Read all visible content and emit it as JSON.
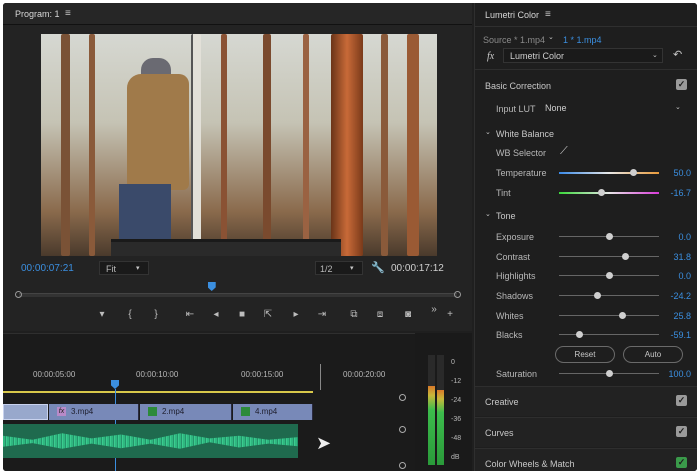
{
  "program": {
    "title": "Program: 1",
    "menu_icon": "hamburger-icon",
    "timecode_current": "00:00:07:21",
    "fit_label": "Fit",
    "resolution": "1/2",
    "timecode_total": "00:00:17:12",
    "playhead_fraction": 0.44
  },
  "transport": {
    "icons": [
      "marker-icon",
      "mark-in-icon",
      "mark-out-icon",
      "go-to-in-icon",
      "step-back-icon",
      "stop-icon",
      "lift-icon",
      "step-forward-icon",
      "go-to-out-icon",
      "insert-icon",
      "overwrite-icon",
      "export-frame-icon",
      "more-icon",
      "add-icon"
    ]
  },
  "timeline": {
    "ruler": [
      "00:00:05:00",
      "00:00:10:00",
      "00:00:15:00",
      "00:00:20:00"
    ],
    "clips": [
      {
        "label": "3.mp4",
        "badge": "fx"
      },
      {
        "label": "2.mp4",
        "badge": ""
      },
      {
        "label": "4.mp4",
        "badge": ""
      }
    ]
  },
  "meter": {
    "labels": [
      "0",
      "-12",
      "-24",
      "-36",
      "-48",
      "dB"
    ],
    "level_left": 0.72,
    "level_right": 0.68
  },
  "lumetri": {
    "title": "Lumetri Color",
    "source": "Source * 1.mp4",
    "sequence": "1 * 1.mp4",
    "effect": "Lumetri Color",
    "basic_correction": "Basic Correction",
    "input_lut_label": "Input LUT",
    "input_lut_value": "None",
    "white_balance": "White Balance",
    "wb_selector": "WB Selector",
    "tone": "Tone",
    "sliders": [
      {
        "label": "Temperature",
        "value": "50.0",
        "fraction": 0.74
      },
      {
        "label": "Tint",
        "value": "-16.7",
        "fraction": 0.42
      },
      {
        "label": "Exposure",
        "value": "0.0",
        "fraction": 0.5
      },
      {
        "label": "Contrast",
        "value": "31.8",
        "fraction": 0.66
      },
      {
        "label": "Highlights",
        "value": "0.0",
        "fraction": 0.5
      },
      {
        "label": "Shadows",
        "value": "-24.2",
        "fraction": 0.38
      },
      {
        "label": "Whites",
        "value": "25.8",
        "fraction": 0.63
      },
      {
        "label": "Blacks",
        "value": "-59.1",
        "fraction": 0.2
      }
    ],
    "reset_label": "Reset",
    "auto_label": "Auto",
    "saturation_label": "Saturation",
    "saturation_value": "100.0",
    "saturation_fraction": 0.5,
    "sections": [
      "Creative",
      "Curves",
      "Color Wheels & Match"
    ]
  }
}
